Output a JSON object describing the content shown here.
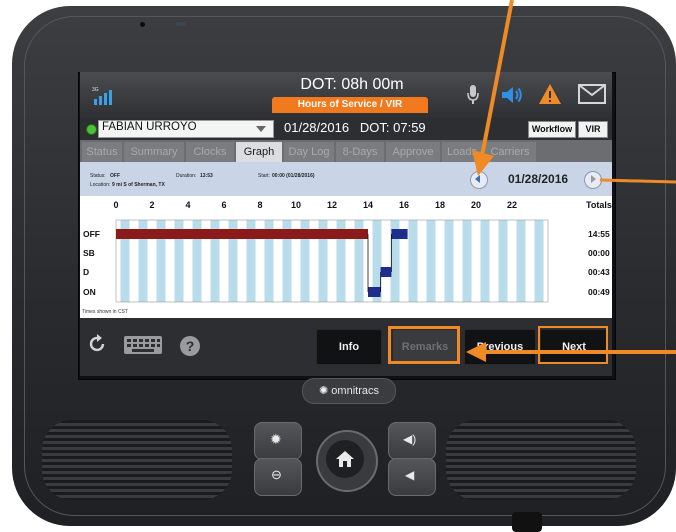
{
  "header": {
    "dot_time": "DOT: 08h 00m",
    "hos_tab": "Hours of Service / VIR",
    "signal_label": "3G"
  },
  "driver": {
    "name": "FABIAN URROYO",
    "date_dot": "01/28/2016   DOT: 07:59",
    "workflow_label": "Workflow",
    "vir_label": "VIR"
  },
  "tabs": [
    {
      "label": "Status",
      "active": false
    },
    {
      "label": "Summary",
      "active": false
    },
    {
      "label": "Clocks",
      "active": false
    },
    {
      "label": "Graph",
      "active": true
    },
    {
      "label": "Day Log",
      "active": false
    },
    {
      "label": "8-Days",
      "active": false
    },
    {
      "label": "Approve",
      "active": false
    },
    {
      "label": "Loads",
      "active": false
    },
    {
      "label": "Carriers",
      "active": false
    }
  ],
  "status_strip": {
    "status_label": "Status:",
    "status_value": "OFF",
    "duration_label": "Duration:",
    "duration_value": "13:53",
    "start_label": "Start:",
    "start_value": "00:00 (01/28/2016)",
    "location_label": "Location:",
    "location_value": "9 mi S of Sherman, TX",
    "date": "01/28/2016"
  },
  "graph": {
    "hour_ticks": [
      "0",
      "2",
      "4",
      "6",
      "8",
      "10",
      "12",
      "14",
      "16",
      "18",
      "20",
      "22"
    ],
    "totals_header": "Totals",
    "rows": [
      {
        "label": "OFF",
        "total": "14:55"
      },
      {
        "label": "SB",
        "total": "00:00"
      },
      {
        "label": "D",
        "total": "00:43"
      },
      {
        "label": "ON",
        "total": "00:49"
      }
    ],
    "footnote": "Times shown in CST",
    "colors": {
      "off": "#8b1a1a",
      "d": "#1f2d8c",
      "on": "#1f2d8c",
      "band": "#b8dcea"
    }
  },
  "buttons": {
    "info": "Info",
    "remarks": "Remarks",
    "previous": "Previous",
    "next": "Next"
  },
  "brand": "omnitracs",
  "accent_color": "#f08a24"
}
